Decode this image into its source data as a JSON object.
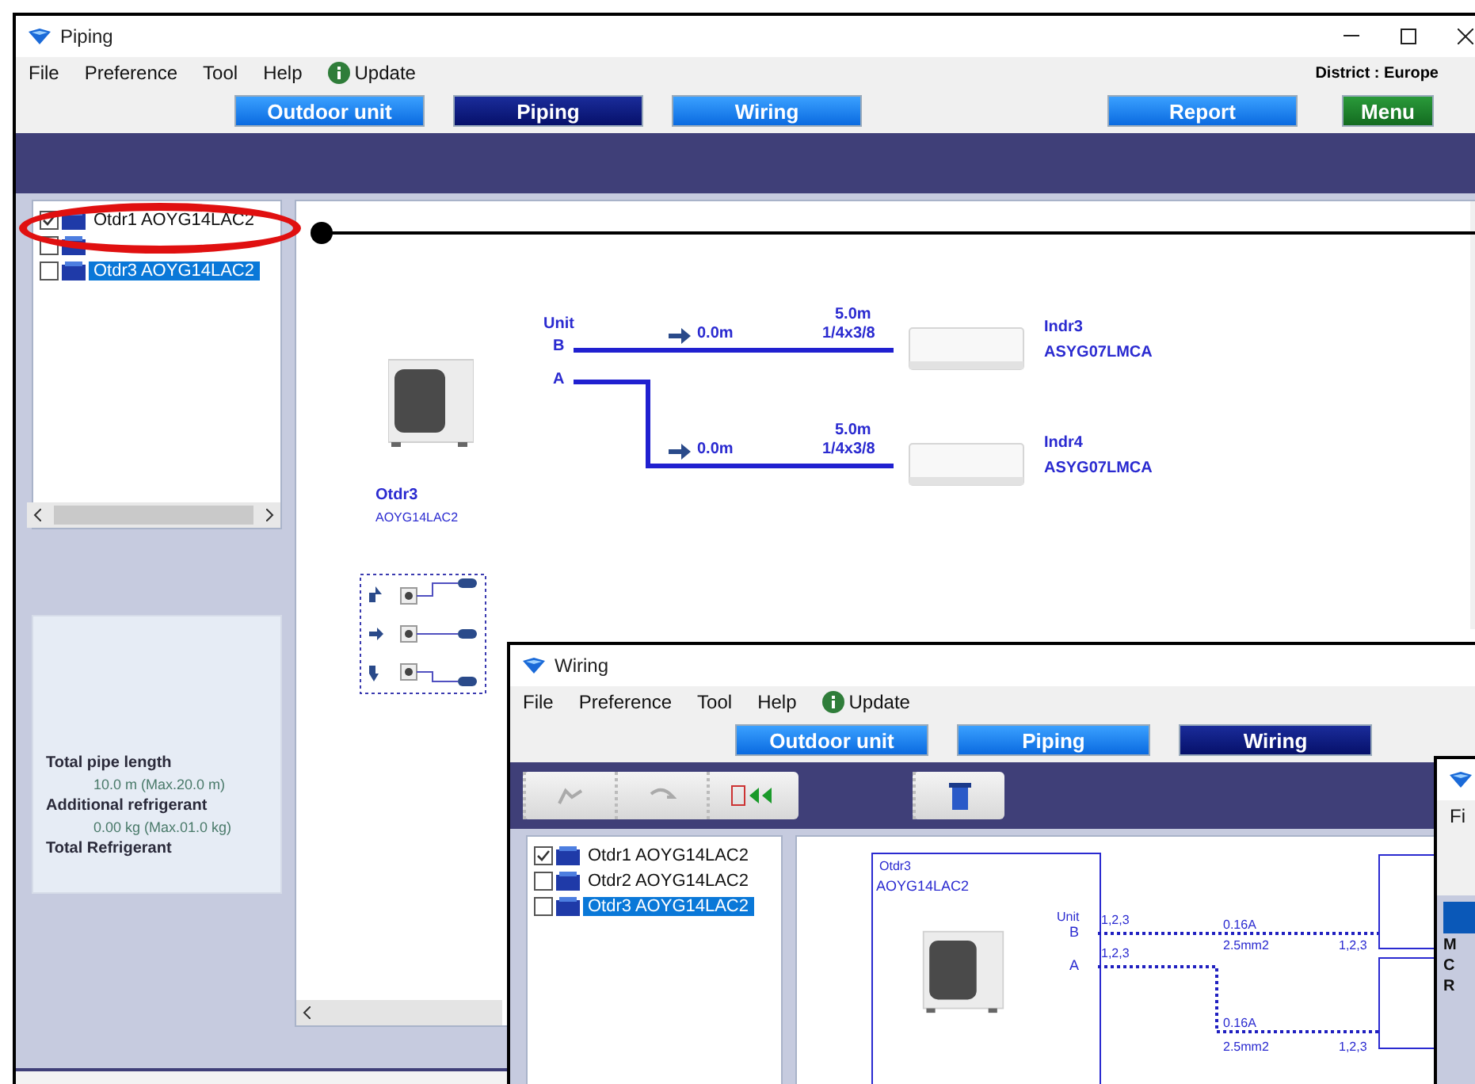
{
  "piping_window": {
    "title": "Piping",
    "menu": [
      "File",
      "Preference",
      "Tool",
      "Help"
    ],
    "update": "Update",
    "district": "District : Europe",
    "nav": [
      {
        "label": "Outdoor unit",
        "selected": false
      },
      {
        "label": "Piping",
        "selected": true
      },
      {
        "label": "Wiring",
        "selected": false
      },
      {
        "label": "Report",
        "selected": false
      }
    ],
    "menu_button": "Menu",
    "tree": [
      {
        "label": "Otdr1 AOYG14LAC2",
        "checked": true,
        "selected": false
      },
      {
        "checked": false,
        "selected": false
      },
      {
        "label": "Otdr3 AOYG14LAC2",
        "checked": false,
        "selected": true
      }
    ],
    "summary": [
      {
        "label": "Total pipe length",
        "value": "10.0 m (Max.20.0 m)"
      },
      {
        "label": "Additional refrigerant",
        "value": "0.00 kg (Max.01.0 kg)"
      },
      {
        "label": "Total Refrigerant"
      }
    ],
    "diagram": {
      "outdoor_name": "Otdr3",
      "outdoor_model": "AOYG14LAC2",
      "unit_label": "Unit",
      "pipes": [
        {
          "port": "B",
          "branch_length": "0.0m",
          "length": "5.0m",
          "size": "1/4x3/8",
          "indoor_name": "Indr3",
          "indoor_model": "ASYG07LMCA"
        },
        {
          "port": "A",
          "branch_length": "0.0m",
          "length": "5.0m",
          "size": "1/4x3/8",
          "indoor_name": "Indr4",
          "indoor_model": "ASYG07LMCA"
        }
      ]
    }
  },
  "wiring_window": {
    "title": "Wiring",
    "menu": [
      "File",
      "Preference",
      "Tool",
      "Help"
    ],
    "update": "Update",
    "nav": [
      {
        "label": "Outdoor unit",
        "selected": false
      },
      {
        "label": "Piping",
        "selected": false
      },
      {
        "label": "Wiring",
        "selected": true
      }
    ],
    "tree": [
      {
        "label": "Otdr1 AOYG14LAC2",
        "checked": true,
        "selected": false
      },
      {
        "label": "Otdr2 AOYG14LAC2",
        "checked": false,
        "selected": false
      },
      {
        "label": "Otdr3 AOYG14LAC2",
        "checked": false,
        "selected": true
      }
    ],
    "diagram": {
      "outdoor_name": "Otdr3",
      "outdoor_model": "AOYG14LAC2",
      "unit_label": "Unit",
      "wires": [
        {
          "port": "B",
          "terminals": "1,2,3",
          "current": "0.16A",
          "cable": "2.5mm2",
          "end_terminals": "1,2,3"
        },
        {
          "port": "A",
          "terminals": "1,2,3",
          "current": "0.16A",
          "cable": "2.5mm2",
          "end_terminals": "1,2,3"
        }
      ]
    }
  },
  "third_window": {
    "menu_fragment": "Fi",
    "rows": [
      "M",
      "C",
      "R"
    ]
  }
}
